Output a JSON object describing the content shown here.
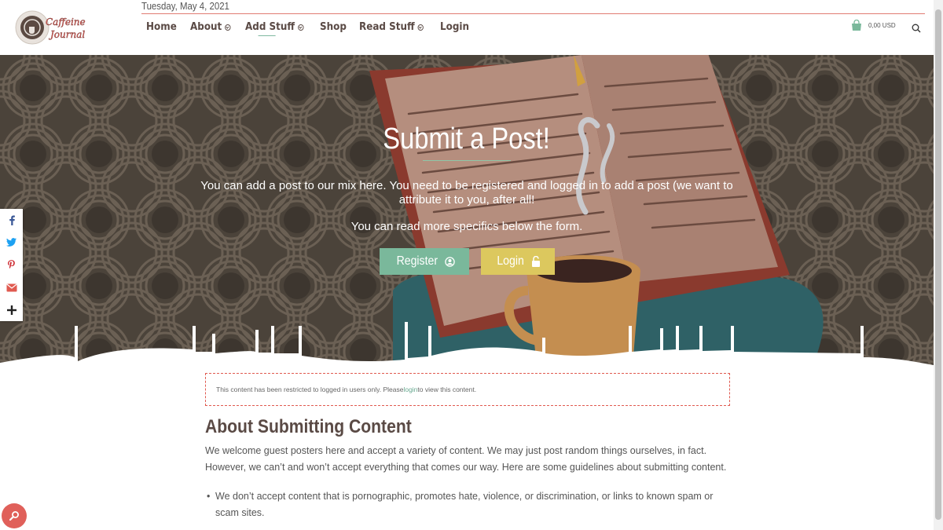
{
  "header": {
    "date": "Tuesday, May 4, 2021",
    "logo_text": "Caffeine Journal",
    "nav": [
      {
        "label": "Home",
        "has_dropdown": false
      },
      {
        "label": "About",
        "has_dropdown": true
      },
      {
        "label": "Add Stuff",
        "has_dropdown": true,
        "active": true
      },
      {
        "label": "Shop",
        "has_dropdown": false
      },
      {
        "label": "Read Stuff",
        "has_dropdown": true
      },
      {
        "label": "Login",
        "has_dropdown": false
      }
    ],
    "cart_total": "0,00 USD",
    "cart_icon": "shopping-bag-icon",
    "search_icon": "search-icon"
  },
  "hero": {
    "title": "Submit a Post!",
    "text1": "You can add a post to our mix here. You need to be registered and logged in to add a post (we want to attribute it to you, after all!",
    "text2": "You can read more specifics below the form.",
    "register_label": "Register",
    "register_icon": "user-circle-icon",
    "login_label": "Login",
    "login_icon": "unlock-icon"
  },
  "share": [
    "facebook-icon",
    "twitter-icon",
    "pinterest-icon",
    "email-icon",
    "plus-icon"
  ],
  "notice": {
    "before": "This content has been restricted to logged in users only. Please ",
    "link": "login",
    "after": " to view this content."
  },
  "about": {
    "heading": "About Submitting Content",
    "paragraph": "We welcome guest posters here and accept a variety of content. We may just post random things ourselves, in fact. However, we can’t and won’t accept everything that comes our way. Here are some guidelines about submitting content.",
    "bullets": [
      "We don’t accept content that is pornographic, promotes hate, violence, or discrimination, or links to known spam or scam sites."
    ]
  },
  "colors": {
    "accent_green": "#7ab89b",
    "accent_yellow": "#dcc85e",
    "accent_red": "#e0605a",
    "hero_bg": "#4a4239",
    "text_brown": "#5a4a45"
  }
}
